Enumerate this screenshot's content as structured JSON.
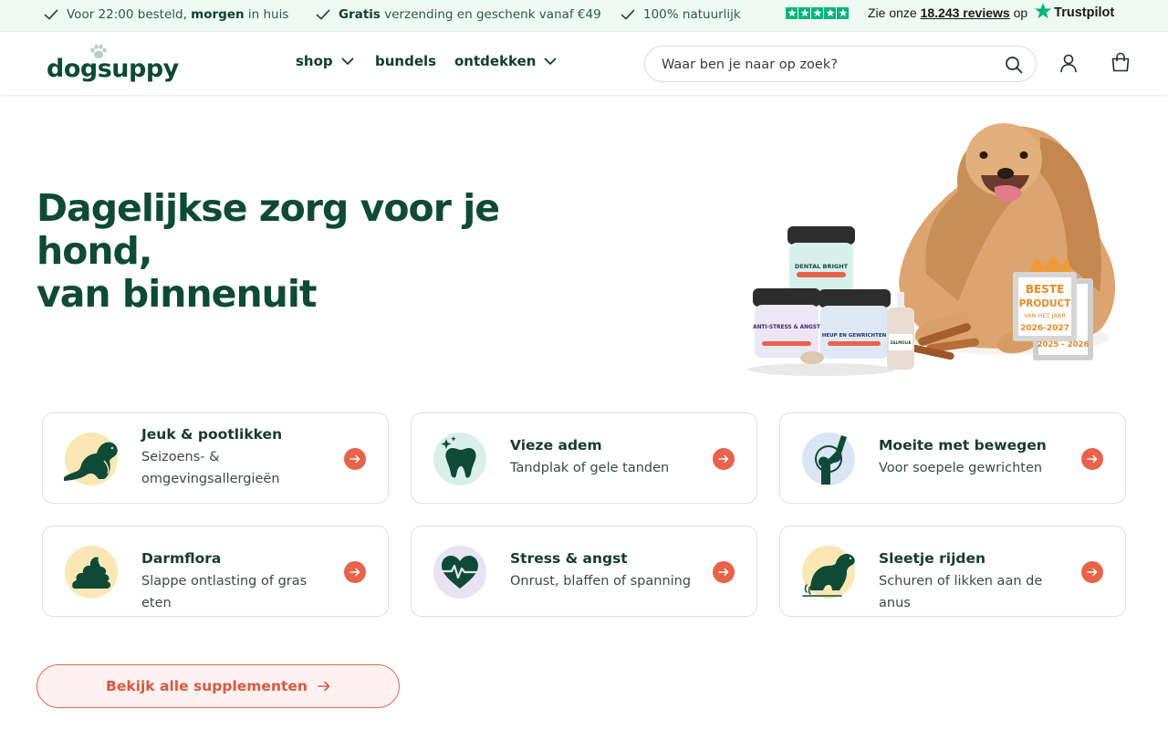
{
  "usp_bar": {
    "items": [
      {
        "prefix": "Voor 22:00 besteld, ",
        "bold": "morgen",
        "suffix": " in huis"
      },
      {
        "prefix": "",
        "bold": "Gratis",
        "suffix": " verzending en geschenk vanaf €49"
      },
      {
        "prefix": "100% natuurlijk",
        "bold": "",
        "suffix": ""
      }
    ],
    "trustpilot": {
      "stars": 5,
      "prefix": "Zie onze ",
      "reviews_link": "18.243 reviews",
      "suffix": " op",
      "brand": "Trustpilot"
    }
  },
  "header": {
    "logo_text": "dogsuppy",
    "nav": [
      {
        "label": "shop",
        "has_dropdown": true
      },
      {
        "label": "bundels",
        "has_dropdown": false
      },
      {
        "label": "ontdekken",
        "has_dropdown": true
      }
    ],
    "search_placeholder": "Waar ben je naar op zoek?"
  },
  "hero": {
    "title_line1": "Dagelijkse zorg voor je hond,",
    "title_line2": "van binnenuit",
    "products": [
      "DENTAL BRIGHT",
      "ANTI-STRESS & ANGST",
      "HEUP EN GEWRICHTEN",
      "ZALMOLIE"
    ],
    "badge": {
      "line1": "BESTE",
      "line2": "PRODUCT",
      "line3": "VAN HET JAAR",
      "line4": "2026-2027",
      "back_year": "2025 - 2026"
    }
  },
  "cards": [
    {
      "title": "Jeuk & pootlikken",
      "subtitle": "Seizoens- & omgevingsallergieën",
      "icon": "scratching-dog-icon",
      "icon_bg": "#fbe7b5"
    },
    {
      "title": "Vieze adem",
      "subtitle": "Tandplak of gele tanden",
      "icon": "tooth-icon",
      "icon_bg": "#d9efe9"
    },
    {
      "title": "Moeite met bewegen",
      "subtitle": "Voor soepele gewrichten",
      "icon": "joint-icon",
      "icon_bg": "#dbe6f5"
    },
    {
      "title": "Darmflora",
      "subtitle": "Slappe ontlasting of gras eten",
      "icon": "poop-icon",
      "icon_bg": "#fbe7b5"
    },
    {
      "title": "Stress & angst",
      "subtitle": "Onrust, blaffen of spanning",
      "icon": "heartbeat-icon",
      "icon_bg": "#e8e2f2"
    },
    {
      "title": "Sleetje rijden",
      "subtitle": "Schuren of likken aan de anus",
      "icon": "scooting-dog-icon",
      "icon_bg": "#fbe7b5"
    }
  ],
  "cta_label": "Bekijk alle supplementen",
  "colors": {
    "brand_green": "#0e4a37",
    "accent_coral": "#e8634a",
    "usp_bg": "#eefaf3",
    "trustpilot_green": "#00b67a"
  }
}
